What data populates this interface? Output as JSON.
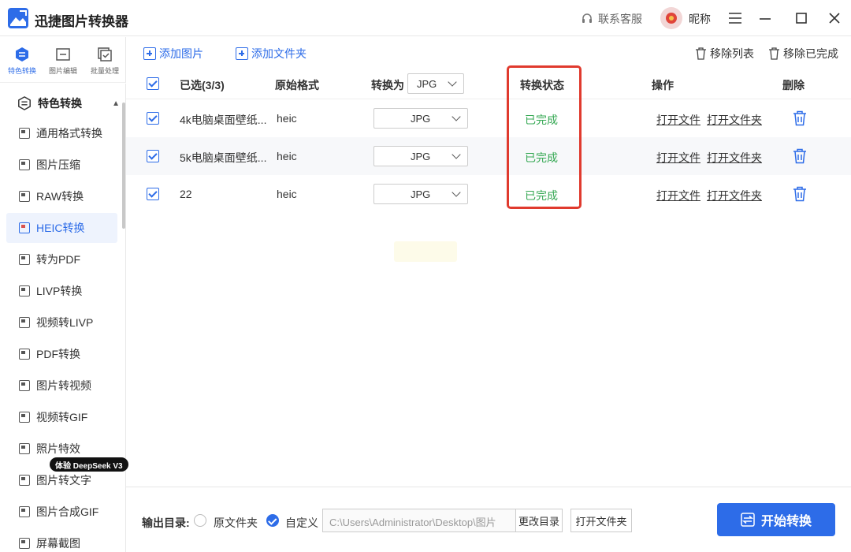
{
  "app": {
    "title": "迅捷图片转换器",
    "support": "联系客服",
    "nickname": "昵称"
  },
  "modes": [
    {
      "label": "特色转换",
      "active": true
    },
    {
      "label": "图片编辑",
      "active": false
    },
    {
      "label": "批量处理",
      "active": false
    }
  ],
  "sidebar": {
    "section": "特色转换",
    "items": [
      {
        "label": "通用格式转换"
      },
      {
        "label": "图片压缩"
      },
      {
        "label": "RAW转换"
      },
      {
        "label": "HEIC转换",
        "active": true
      },
      {
        "label": "转为PDF"
      },
      {
        "label": "LIVP转换"
      },
      {
        "label": "视频转LIVP"
      },
      {
        "label": "PDF转换"
      },
      {
        "label": "图片转视频"
      },
      {
        "label": "视频转GIF"
      },
      {
        "label": "照片特效"
      },
      {
        "label": "图片转文字"
      },
      {
        "label": "图片合成GIF"
      },
      {
        "label": "屏幕截图"
      }
    ],
    "promo": "体验 DeepSeek V3"
  },
  "toolbar": {
    "add_image": "添加图片",
    "add_folder": "添加文件夹",
    "remove_list": "移除列表",
    "remove_done": "移除已完成"
  },
  "table": {
    "headers": {
      "selected": "已选(3/3)",
      "orig_format": "原始格式",
      "convert_to": "转换为",
      "convert_to_value": "JPG",
      "status": "转换状态",
      "actions": "操作",
      "delete": "删除"
    },
    "rows": [
      {
        "name": "4k电脑桌面壁纸...",
        "format": "heic",
        "target": "JPG",
        "status": "已完成",
        "open_file": "打开文件",
        "open_folder": "打开文件夹"
      },
      {
        "name": "5k电脑桌面壁纸...",
        "format": "heic",
        "target": "JPG",
        "status": "已完成",
        "open_file": "打开文件",
        "open_folder": "打开文件夹"
      },
      {
        "name": "22",
        "format": "heic",
        "target": "JPG",
        "status": "已完成",
        "open_file": "打开文件",
        "open_folder": "打开文件夹"
      }
    ]
  },
  "bottom": {
    "output_label": "输出目录:",
    "option_original": "原文件夹",
    "option_custom": "自定义",
    "path": "C:\\Users\\Administrator\\Desktop\\图片",
    "change_dir": "更改目录",
    "open_folder": "打开文件夹",
    "start": "开始转换"
  },
  "colors": {
    "accent": "#2d6ce8",
    "success": "#35a853",
    "highlight": "#e03a2e"
  }
}
